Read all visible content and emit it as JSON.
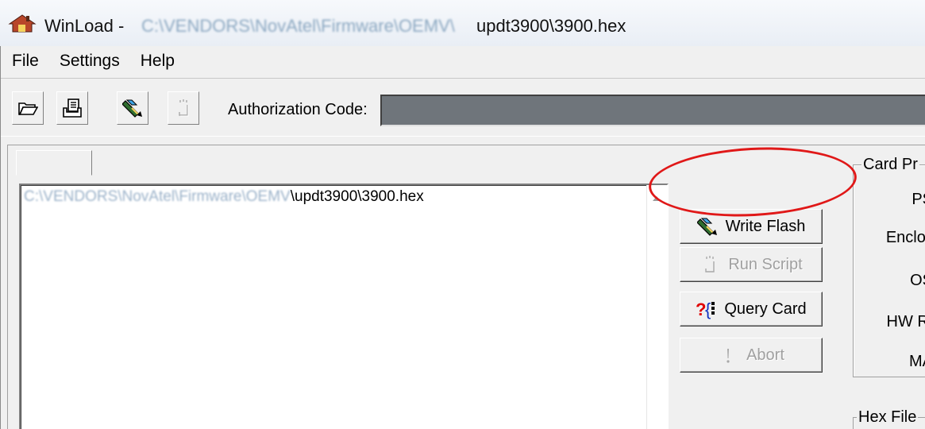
{
  "window": {
    "title_prefix": "WinLoad -",
    "title_path_obscured": "C:\\VENDORS\\NovAtel\\Firmware\\OEMV\\",
    "title_file": "updt3900\\3900.hex"
  },
  "menu": {
    "items": [
      {
        "label": "File"
      },
      {
        "label": "Settings"
      },
      {
        "label": "Help"
      }
    ]
  },
  "toolbar": {
    "buttons": [
      {
        "icon": "folder-open-icon"
      },
      {
        "icon": "document-icon"
      },
      {
        "icon": "write-flash-icon"
      },
      {
        "icon": "run-script-icon"
      }
    ],
    "auth_label": "Authorization Code:",
    "auth_value": ""
  },
  "file_list": {
    "rows": [
      {
        "path_obscured": "C:\\VENDORS\\NovAtel\\Firmware\\OEMV",
        "file": "\\updt3900\\3900.hex"
      }
    ]
  },
  "actions": {
    "write_flash": "Write Flash",
    "run_script": "Run Script",
    "query_card": "Query Card",
    "abort": "Abort"
  },
  "card_properties": {
    "legend": "Card Pr",
    "labels": [
      "PS",
      "Enclosu",
      "OS",
      "HW Re",
      "MA"
    ]
  },
  "hex_file": {
    "legend": "Hex File"
  },
  "colors": {
    "annotation": "#e01818",
    "auth_field": "#6f757b",
    "query_icon": "#e00000"
  }
}
